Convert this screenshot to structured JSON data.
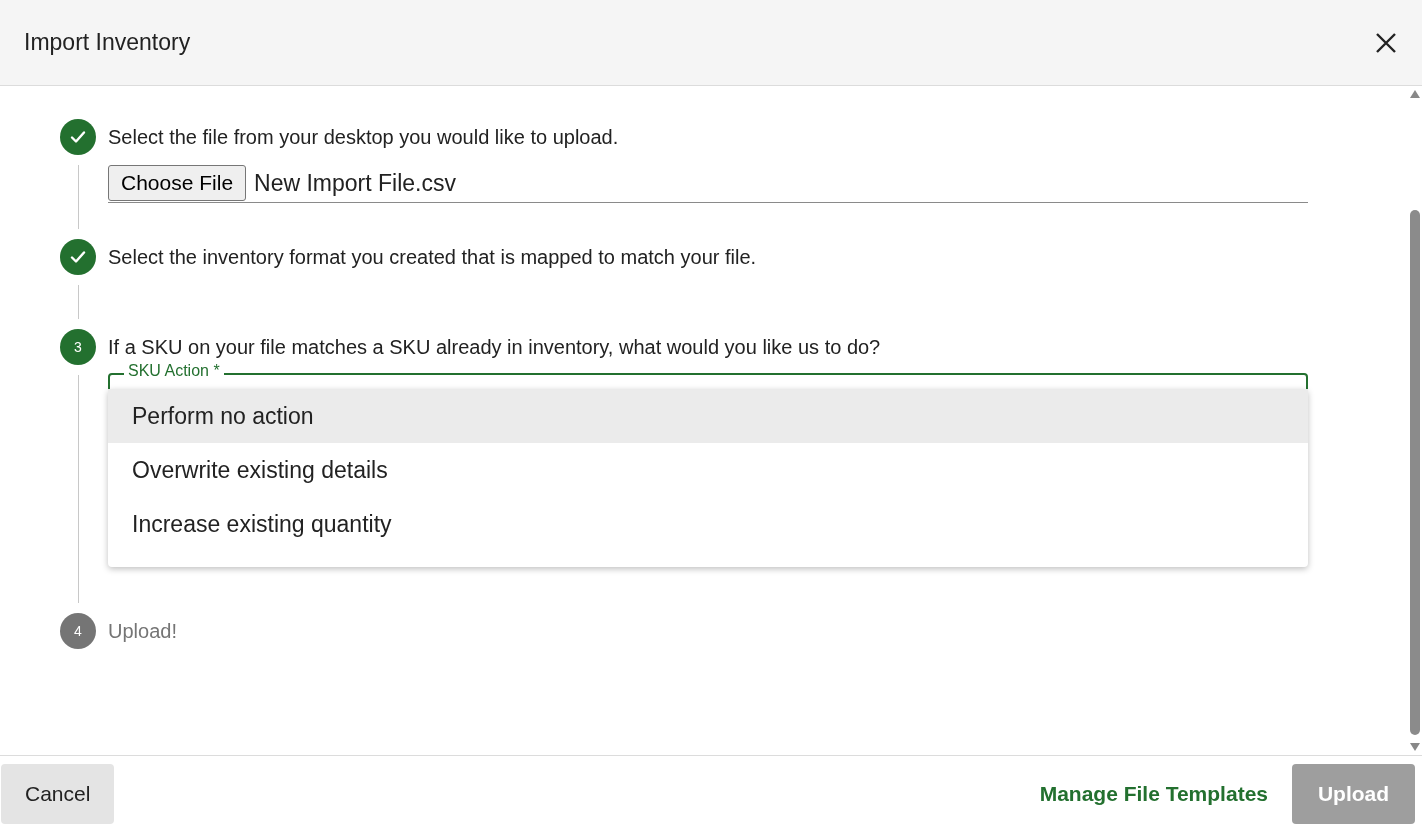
{
  "dialog": {
    "title": "Import Inventory"
  },
  "steps": [
    {
      "completed": true,
      "disabled": false,
      "text": "Select the file from your desktop you would like to upload.",
      "kind": "file",
      "file_button": "Choose File",
      "file_name": "New Import File.csv"
    },
    {
      "completed": true,
      "disabled": false,
      "text": "Select the inventory format you created that is mapped to match your file."
    },
    {
      "number": "3",
      "completed": false,
      "disabled": false,
      "text": "If a SKU on your file matches a SKU already in inventory, what would you like us to do?",
      "kind": "select",
      "field_label": "SKU Action *",
      "options": [
        {
          "label": "Perform no action",
          "selected": true
        },
        {
          "label": "Overwrite existing details",
          "selected": false
        },
        {
          "label": "Increase existing quantity",
          "selected": false
        }
      ]
    },
    {
      "number": "4",
      "completed": false,
      "disabled": true,
      "text": "Upload!"
    }
  ],
  "footer": {
    "cancel": "Cancel",
    "link": "Manage File Templates",
    "upload": {
      "label": "Upload",
      "disabled": true
    }
  }
}
